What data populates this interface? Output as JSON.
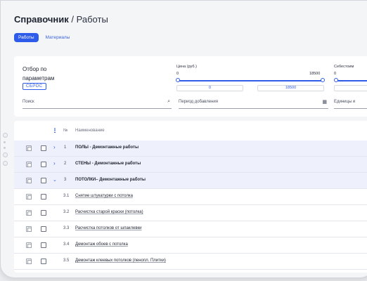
{
  "header": {
    "title_main": "Справочник",
    "separator": "/",
    "title_sub": "Работы"
  },
  "tabs": [
    {
      "label": "Работы",
      "active": true
    },
    {
      "label": "Материалы",
      "active": false
    }
  ],
  "filter": {
    "title": "Отбор по параметрам",
    "reset_label": "СБРОС",
    "price": {
      "label": "Цена (руб.)",
      "min": "0",
      "max": "18500",
      "from": "0",
      "to": "18500"
    },
    "cost": {
      "label": "Себестоим",
      "min": "0"
    },
    "search_placeholder": "Поиск",
    "period_placeholder": "Период добавления",
    "units_placeholder": "Единицы и"
  },
  "table": {
    "headers": {
      "sort_icon": "I",
      "num": "№",
      "name": "Наименование"
    },
    "rows": [
      {
        "num": "1",
        "name": "ПОЛЫ - Демонтажные работы",
        "group": true,
        "expanded": false
      },
      {
        "num": "2",
        "name": "СТЕНЫ - Демонтажные работы",
        "group": true,
        "expanded": false
      },
      {
        "num": "3",
        "name": "ПОТОЛКИ– Демонтажные работы",
        "group": true,
        "expanded": true
      },
      {
        "num": "3.1",
        "name": "Снятие штукатурки с потолка",
        "group": false
      },
      {
        "num": "3.2",
        "name": "Расчистка старой краски (потолка)",
        "group": false
      },
      {
        "num": "3.3",
        "name": "Расчистка потолков от шпаклевки",
        "group": false
      },
      {
        "num": "3.4",
        "name": "Демонтаж обоев с потолка",
        "group": false
      },
      {
        "num": "3.5",
        "name": "Демонтаж клеевых потолков (пенопл. Плитки)",
        "group": false
      }
    ]
  },
  "colors": {
    "accent": "#2f5bea",
    "group_row_bg": "#eef1fb"
  },
  "icons": {
    "search": "search-icon",
    "calendar": "calendar-icon",
    "expand": "chevron-right-icon",
    "collapse": "chevron-down-icon",
    "copy": "copy-icon"
  }
}
